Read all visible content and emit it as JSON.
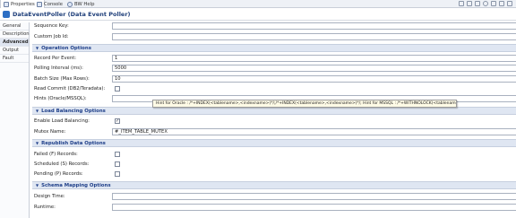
{
  "tabs": [
    {
      "label": "Properties",
      "suffix": "✕"
    },
    {
      "label": "Console"
    },
    {
      "label": "BW Help"
    }
  ],
  "title": "DataEventPoller (Data Event Poller)",
  "sidebar": {
    "items": [
      "General",
      "Description",
      "Advanced",
      "Output",
      "Fault"
    ],
    "selected": "Advanced"
  },
  "fields": {
    "sequence_key": {
      "label": "Sequence Key:",
      "value": ""
    },
    "custom_job_id": {
      "label": "Custom Job Id:",
      "value": ""
    }
  },
  "sections": {
    "operation": {
      "title": "Operation Options",
      "record_per_event": {
        "label": "Record Per Event:",
        "value": "1"
      },
      "polling_interval": {
        "label": "Polling Interval (ms):",
        "value": "5000"
      },
      "batch_size": {
        "label": "Batch Size (Max Rows):",
        "value": "10"
      },
      "read_commit": {
        "label": "Read Commit (DB2/Teradata):",
        "checked": false
      },
      "hints": {
        "label": "Hints (Oracle/MSSQL):",
        "value": ""
      }
    },
    "load_balancing": {
      "title": "Load Balancing Options",
      "enable": {
        "label": "Enable Load Balancing:",
        "checked": true,
        "mark": "✓"
      },
      "mutex": {
        "label": "Mutex Name:",
        "value": "#_ITEM_TABLE_MUTEX"
      }
    },
    "republish": {
      "title": "Republish Data Options",
      "failed": {
        "label": "Failed (F) Records:",
        "checked": false
      },
      "scheduled": {
        "label": "Scheduled (S) Records:",
        "checked": false
      },
      "pending": {
        "label": "Pending (P) Records:",
        "checked": false
      }
    },
    "schema": {
      "title": "Schema Mapping Options",
      "design_time": {
        "label": "Design Time:",
        "value": ""
      },
      "runtime": {
        "label": "Runtime:",
        "value": ""
      }
    }
  },
  "tooltip": "Hint for Oracle : /*+INDEX(<tablename>,<indexname>)*/;/*+INDEX(<tablename>,<indexname>)*/; Hint for MSSQL : /*+WITHNOLOCK(<tablename>)*/",
  "icons": {
    "tab1": "properties-icon",
    "tab2": "console-icon",
    "tab3": "help-icon",
    "title": "poller-icon"
  }
}
